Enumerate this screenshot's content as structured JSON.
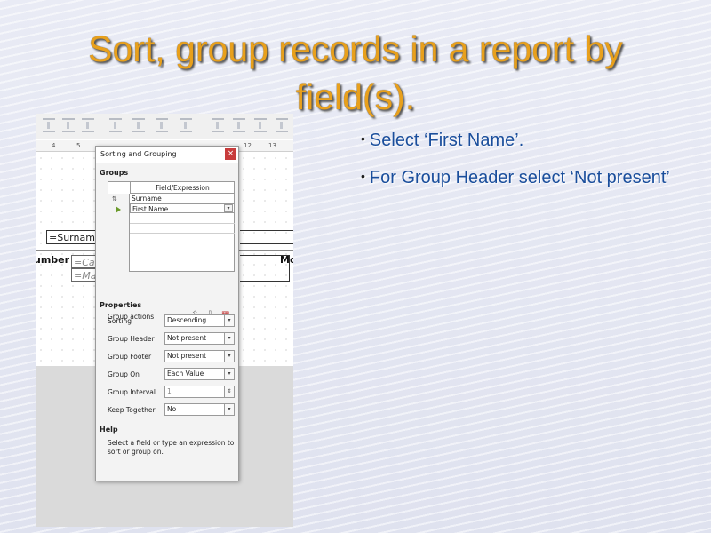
{
  "slide": {
    "title": "Sort, group records in a report by field(s).",
    "bullets": [
      "Select ‘First Name’.",
      "For Group Header select ‘Not present’"
    ]
  },
  "colors": {
    "title": "#e8a01c",
    "bullet": "#1a4e9c"
  },
  "report": {
    "ruler_ticks": [
      "4",
      "5",
      "12",
      "13"
    ],
    "surname_field": "=Surname",
    "number_label": "umber",
    "mo_label": "Mo",
    "car_field": "=Car",
    "make_field": "=Mak"
  },
  "dialog": {
    "title": "Sorting and Grouping",
    "close_icon": "close-icon",
    "groups_heading": "Groups",
    "column_header": "Field/Expression",
    "rows": [
      "Surname",
      "First Name"
    ],
    "group_actions_label": "Group actions",
    "properties_heading": "Properties",
    "properties": [
      {
        "label": "Sorting",
        "value": "Descending"
      },
      {
        "label": "Group Header",
        "value": "Not present"
      },
      {
        "label": "Group Footer",
        "value": "Not present"
      },
      {
        "label": "Group On",
        "value": "Each Value"
      },
      {
        "label": "Group Interval",
        "value": "1"
      },
      {
        "label": "Keep Together",
        "value": "No"
      }
    ],
    "help_heading": "Help",
    "help_text": "Select a field or type an expression to sort or group on."
  }
}
